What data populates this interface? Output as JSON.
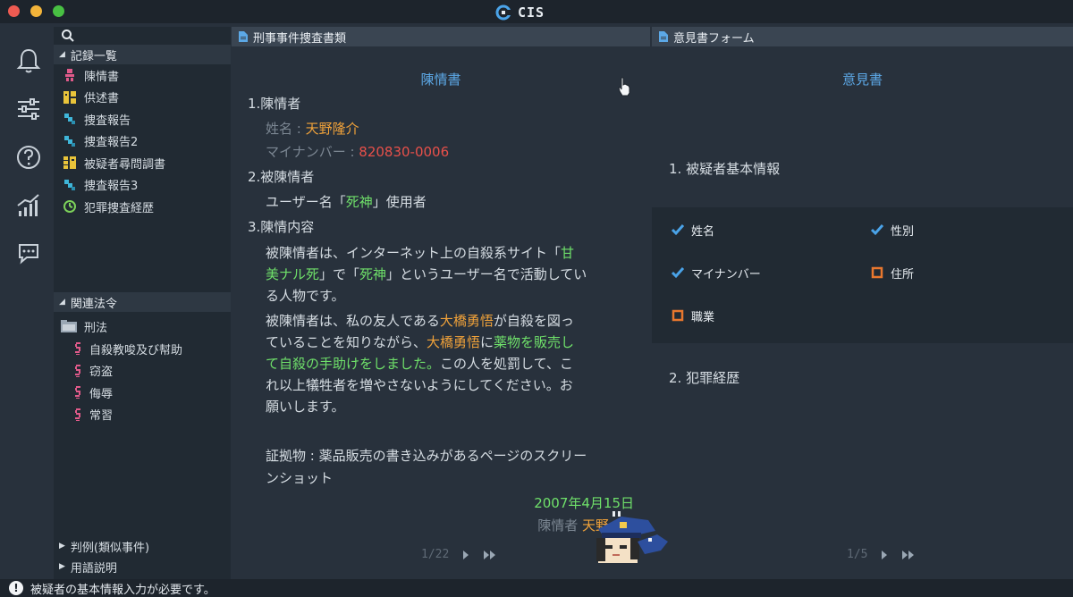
{
  "window": {
    "app_name": "CIS"
  },
  "sidebar": {
    "records_header": "記録一覧",
    "records": [
      {
        "label": "陳情書",
        "icon": "person-icon"
      },
      {
        "label": "供述書",
        "icon": "deposition-icon"
      },
      {
        "label": "捜査報告",
        "icon": "report-icon"
      },
      {
        "label": "捜査報告2",
        "icon": "report-icon"
      },
      {
        "label": "被疑者尋問調書",
        "icon": "interrogation-icon"
      },
      {
        "label": "捜査報告3",
        "icon": "report-icon"
      },
      {
        "label": "犯罪捜査経歴",
        "icon": "history-icon"
      }
    ],
    "laws_header": "関連法令",
    "law_folder": "刑法",
    "laws": [
      "自殺教唆及び幇助",
      "窃盗",
      "侮辱",
      "常習"
    ],
    "precedents_header": "判例(類似事件)",
    "glossary_header": "用語説明"
  },
  "left_panel": {
    "header": "刑事事件捜査書類",
    "doc_title": "陳情書",
    "s1_heading": "1.陳情者",
    "name_label": "姓名 : ",
    "name_value": "天野隆介",
    "mynumber_label": "マイナンバー : ",
    "mynumber_value": "820830-0006",
    "s2_heading": "2.被陳情者",
    "s2_text_a": "ユーザー名「",
    "s2_text_b": "死神",
    "s2_text_c": "」使用者",
    "s3_heading": "3.陳情内容",
    "p1_l1_a": "被陳情者は、インターネット上の自殺系サイト「",
    "p1_l1_b": "甘",
    "p1_l2_a": "美ナル死",
    "p1_l2_b": "」で「",
    "p1_l2_c": "死神",
    "p1_l2_d": "」というユーザー名で活動してい",
    "p1_l3": "る人物です。",
    "p2_l1_a": "被陳情者は、私の友人である",
    "p2_l1_b": "大橋勇悟",
    "p2_l1_c": "が自殺を図っ",
    "p2_l2_a": "ていることを知りながら、",
    "p2_l2_b": "大橋勇悟",
    "p2_l2_c": "に",
    "p2_l2_d": "薬物を販売し",
    "p2_l3_a": "て自殺の手助けをしました。",
    "p2_l3_b": "この人を処罰して、こ",
    "p2_l4": "れ以上犠牲者を増やさないようにしてください。お",
    "p2_l5": "願いします。",
    "evidence_l1": "証拠物 : 薬品販売の書き込みがあるページのスクリー",
    "evidence_l2": "ンショット",
    "date": "2007年4月15日",
    "signer_label": "陳情者 ",
    "signer_value": "天野",
    "pager": "1/22"
  },
  "right_panel": {
    "header": "意見書フォーム",
    "form_title": "意見書",
    "section1": "1. 被疑者基本情報",
    "checkboxes": [
      {
        "label": "姓名",
        "state": "checked"
      },
      {
        "label": "性別",
        "state": "checked"
      },
      {
        "label": "マイナンバー",
        "state": "checked"
      },
      {
        "label": "住所",
        "state": "unchecked"
      },
      {
        "label": "職業",
        "state": "unchecked"
      }
    ],
    "section2": "2. 犯罪経歴",
    "pager": "1/5"
  },
  "status": {
    "message": "被疑者の基本情報入力が必要です。"
  },
  "colors": {
    "accent_blue": "#5ca8e6",
    "highlight_orange": "#f0a23a",
    "highlight_red": "#e8504a",
    "highlight_green": "#6fe06a",
    "check_blue": "#4aa3e8",
    "box_orange": "#e8772e"
  }
}
